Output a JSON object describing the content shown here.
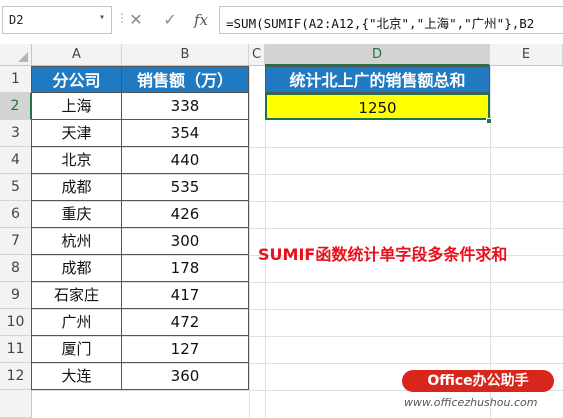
{
  "formula_bar": {
    "name_box": "D2",
    "cancel_icon": "✕",
    "enter_icon": "✓",
    "fx_label": "fx",
    "formula": "=SUM(SUMIF(A2:A12,{\"北京\",\"上海\",\"广州\"},B2"
  },
  "columns": [
    "A",
    "B",
    "C",
    "D",
    "E"
  ],
  "rows": [
    "1",
    "2",
    "3",
    "4",
    "5",
    "6",
    "7",
    "8",
    "9",
    "10",
    "11",
    "12"
  ],
  "table": {
    "headers": [
      "分公司",
      "销售额（万）"
    ],
    "data": [
      [
        "上海",
        "338"
      ],
      [
        "天津",
        "354"
      ],
      [
        "北京",
        "440"
      ],
      [
        "成都",
        "535"
      ],
      [
        "重庆",
        "426"
      ],
      [
        "杭州",
        "300"
      ],
      [
        "成都",
        "178"
      ],
      [
        "石家庄",
        "417"
      ],
      [
        "广州",
        "472"
      ],
      [
        "厦门",
        "127"
      ],
      [
        "大连",
        "360"
      ]
    ]
  },
  "summary": {
    "header": "统计北上广的销售额总和",
    "value": "1250"
  },
  "annotation": "SUMIF函数统计单字段多条件求和",
  "watermark": {
    "brand": "Office办公助手",
    "url": "www.officezhushou.com"
  },
  "colors": {
    "header_blue": "#1f7ac2",
    "highlight_yellow": "#ffff00",
    "annotation_red": "#e8101c",
    "excel_green": "#217346"
  }
}
